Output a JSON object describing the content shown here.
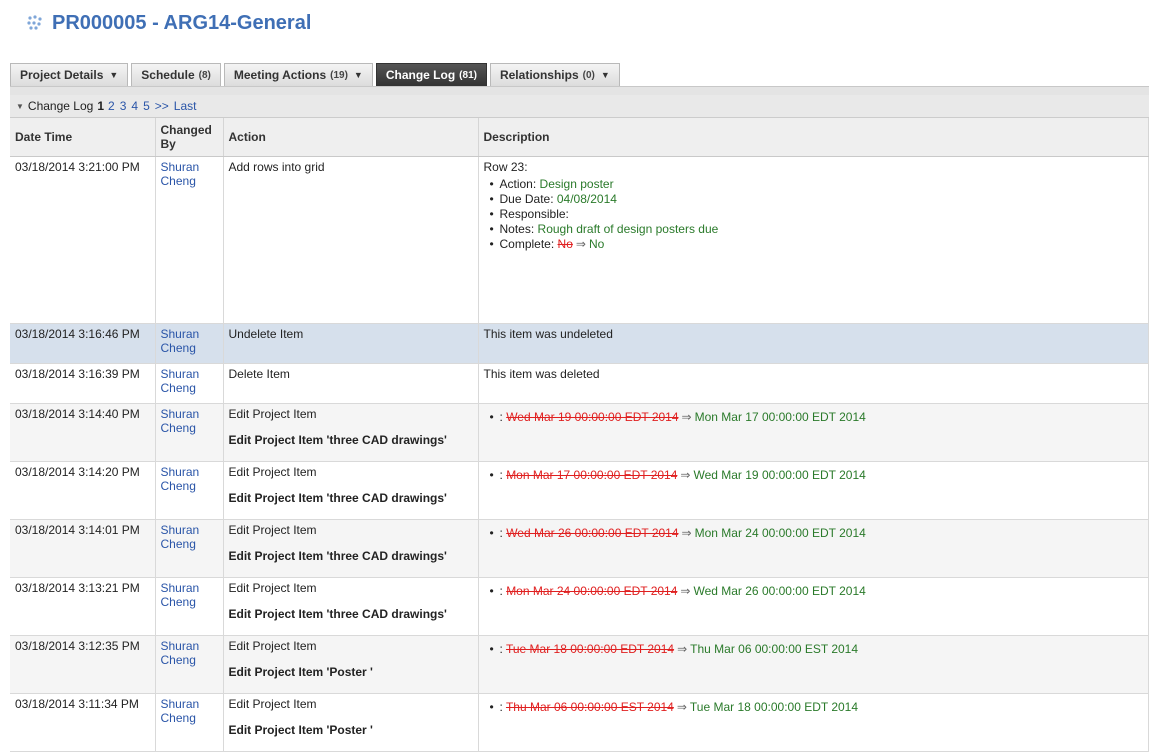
{
  "header": {
    "title": "PR000005 - ARG14-General"
  },
  "tabs": [
    {
      "label": "Project Details",
      "count": "",
      "caret": true,
      "active": false
    },
    {
      "label": "Schedule",
      "count": "(8)",
      "caret": false,
      "active": false
    },
    {
      "label": "Meeting Actions",
      "count": "(19)",
      "caret": true,
      "active": false
    },
    {
      "label": "Change Log",
      "count": "(81)",
      "caret": false,
      "active": true
    },
    {
      "label": "Relationships",
      "count": "(0)",
      "caret": true,
      "active": false
    }
  ],
  "pager": {
    "label": "Change Log",
    "current": "1",
    "pages": [
      "2",
      "3",
      "4",
      "5"
    ],
    "next": ">>",
    "last": "Last"
  },
  "columns": {
    "datetime": "Date Time",
    "changed_by": "Changed By",
    "action": "Action",
    "description": "Description"
  },
  "rows": [
    {
      "datetime": "03/18/2014 3:21:00 PM",
      "user_first": "Shuran",
      "user_last": "Cheng",
      "action": "Add rows into grid",
      "row_label": "Row 23:",
      "items": {
        "action_key": "Action:",
        "action_val": "Design poster",
        "due_key": "Due Date:",
        "due_val": "04/08/2014",
        "resp_key": "Responsible:",
        "notes_key": "Notes:",
        "notes_val": "Rough draft of design posters due",
        "complete_key": "Complete:",
        "complete_old": "No",
        "complete_new": "No"
      }
    },
    {
      "datetime": "03/18/2014 3:16:46 PM",
      "user_first": "Shuran",
      "user_last": "Cheng",
      "action": "Undelete Item",
      "description": "This item was undeleted"
    },
    {
      "datetime": "03/18/2014 3:16:39 PM",
      "user_first": "Shuran",
      "user_last": "Cheng",
      "action": "Delete Item",
      "description": "This item was deleted"
    },
    {
      "datetime": "03/18/2014 3:14:40 PM",
      "user_first": "Shuran",
      "user_last": "Cheng",
      "action": "Edit Project Item",
      "sub": "Edit Project Item 'three CAD drawings'",
      "prefix": ":",
      "old": "Wed Mar 19 00:00:00 EDT 2014",
      "new": "Mon Mar 17 00:00:00 EDT 2014"
    },
    {
      "datetime": "03/18/2014 3:14:20 PM",
      "user_first": "Shuran",
      "user_last": "Cheng",
      "action": "Edit Project Item",
      "sub": "Edit Project Item 'three CAD drawings'",
      "prefix": ":",
      "old": "Mon Mar 17 00:00:00 EDT 2014",
      "new": "Wed Mar 19 00:00:00 EDT 2014"
    },
    {
      "datetime": "03/18/2014 3:14:01 PM",
      "user_first": "Shuran",
      "user_last": "Cheng",
      "action": "Edit Project Item",
      "sub": "Edit Project Item 'three CAD drawings'",
      "prefix": ":",
      "old": "Wed Mar 26 00:00:00 EDT 2014",
      "new": "Mon Mar 24 00:00:00 EDT 2014"
    },
    {
      "datetime": "03/18/2014 3:13:21 PM",
      "user_first": "Shuran",
      "user_last": "Cheng",
      "action": "Edit Project Item",
      "sub": "Edit Project Item 'three CAD drawings'",
      "prefix": ":",
      "old": "Mon Mar 24 00:00:00 EDT 2014",
      "new": "Wed Mar 26 00:00:00 EDT 2014"
    },
    {
      "datetime": "03/18/2014 3:12:35 PM",
      "user_first": "Shuran",
      "user_last": "Cheng",
      "action": "Edit Project Item",
      "sub": "Edit Project Item 'Poster '",
      "prefix": ":",
      "old": "Tue Mar 18 00:00:00 EDT 2014",
      "new": "Thu Mar 06 00:00:00 EST 2014"
    },
    {
      "datetime": "03/18/2014 3:11:34 PM",
      "user_first": "Shuran",
      "user_last": "Cheng",
      "action": "Edit Project Item",
      "sub": "Edit Project Item 'Poster '",
      "prefix": ":",
      "old": "Thu Mar 06 00:00:00 EST 2014",
      "new": "Tue Mar 18 00:00:00 EDT 2014"
    }
  ],
  "colors": {
    "title": "#3f6fb5",
    "link": "#2a55a8",
    "new_value": "#2a7a2a",
    "old_value": "#e02020",
    "highlight_row": "#d6e0ec"
  }
}
